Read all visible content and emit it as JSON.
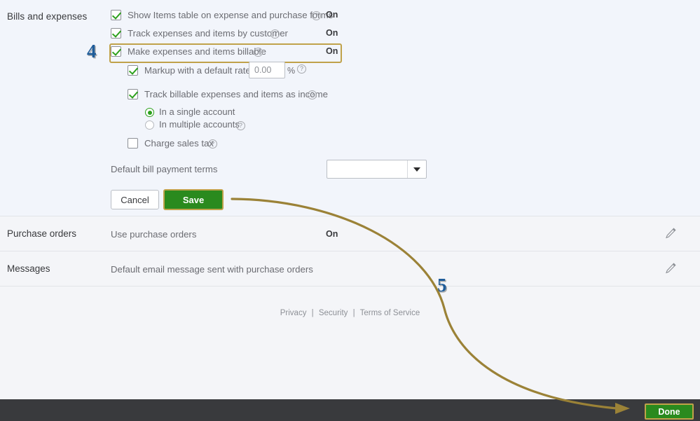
{
  "section": {
    "label": "Bills and expenses",
    "options": [
      {
        "label": "Show Items table on expense and purchase forms",
        "checked": true,
        "help": "?",
        "value": "On"
      },
      {
        "label": "Track expenses and items by customer",
        "checked": true,
        "help": "?",
        "value": "On"
      },
      {
        "label": "Make expenses and items billable",
        "checked": true,
        "help": "?",
        "value": "On",
        "highlighted": true
      }
    ],
    "markup": {
      "label": "Markup with a default rate of",
      "checked": true,
      "input_value": "0.00",
      "unit": "%",
      "help": "?"
    },
    "track_income": {
      "label": "Track billable expenses and items as income",
      "checked": true,
      "help": "?"
    },
    "account_options": [
      {
        "label": "In a single account",
        "selected": true,
        "help": ""
      },
      {
        "label": "In multiple accounts",
        "selected": false,
        "help": "?"
      }
    ],
    "sales_tax": {
      "label": "Charge sales tax",
      "checked": false,
      "help": "?"
    },
    "bill_terms": {
      "label": "Default bill payment terms",
      "value": "",
      "caret_icon": "chevron-down-icon"
    },
    "buttons": {
      "cancel": "Cancel",
      "save": "Save"
    }
  },
  "collapsed_rows": [
    {
      "label": "Purchase orders",
      "description": "Use purchase orders",
      "value": "On",
      "edit_icon": "pencil-icon"
    },
    {
      "label": "Messages",
      "description": "Default email message sent with purchase orders",
      "value": "",
      "edit_icon": "pencil-icon"
    }
  ],
  "footer": {
    "privacy": "Privacy",
    "security": "Security",
    "terms": "Terms of Service",
    "separator": "|"
  },
  "bottom_bar": {
    "done_label": "Done"
  },
  "annotations": {
    "marker_four": "4",
    "marker_five": "5"
  },
  "colors": {
    "accent_green": "#2a8a1e",
    "highlight_gold": "#c0a24a",
    "marker_blue": "#1f5c99",
    "bar_dark": "#393a3d"
  }
}
